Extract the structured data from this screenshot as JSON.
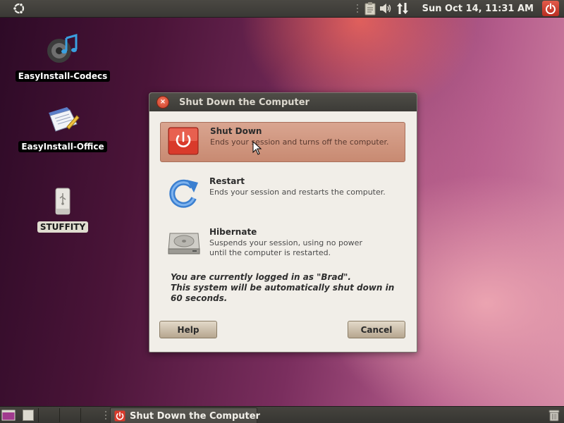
{
  "top_panel": {
    "clock": "Sun Oct 14, 11:31 AM",
    "icons": [
      "ubuntu-logo-icon",
      "clipboard-icon",
      "volume-icon",
      "network-icon",
      "power-icon"
    ]
  },
  "desktop_icons": [
    {
      "label": "EasyInstall-Codecs",
      "icon": "speaker-music-icon"
    },
    {
      "label": "EasyInstall-Office",
      "icon": "office-document-icon"
    },
    {
      "label": "STUFFITY",
      "icon": "usb-drive-icon"
    }
  ],
  "dialog": {
    "title": "Shut Down the Computer",
    "options": [
      {
        "title": "Shut Down",
        "desc": "Ends your session and turns off the computer.",
        "icon": "power-icon",
        "selected": true
      },
      {
        "title": "Restart",
        "desc": "Ends your session and restarts the computer.",
        "icon": "restart-icon",
        "selected": false
      },
      {
        "title": "Hibernate",
        "desc": "Suspends your session, using no power\nuntil the computer is restarted.",
        "icon": "hard-drive-icon",
        "selected": false
      }
    ],
    "notice_line1": "You are currently logged in as \"Brad\".",
    "notice_line2": "This system will be automatically shut down in",
    "notice_line3": "60 seconds.",
    "help_label": "Help",
    "cancel_label": "Cancel"
  },
  "bottom_panel": {
    "task_label": "Shut Down the Computer",
    "icons": [
      "show-desktop-icon",
      "workspace-switcher-icon",
      "trash-icon"
    ]
  },
  "colors": {
    "panel": "#3c3b37",
    "selection": "#d09a84",
    "power_red": "#d93a2b"
  }
}
